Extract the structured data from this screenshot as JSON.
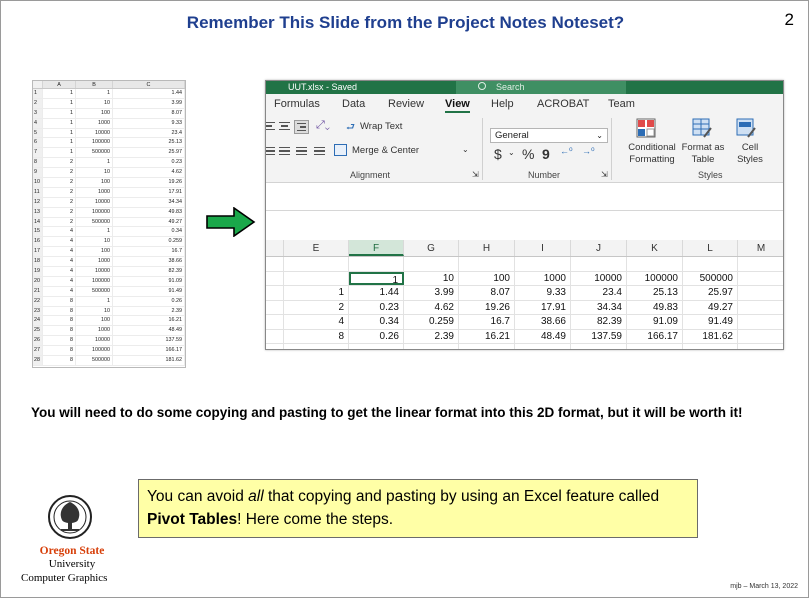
{
  "slide": {
    "title": "Remember This Slide from the Project Notes Noteset?",
    "page_number": "2",
    "body_text": "You will need to do some copying and pasting to get the linear format into this 2D format, but it will be worth it!",
    "callout": {
      "before_all": "You can avoid ",
      "all": "all",
      "after_all": " that copying and pasting by using an Excel feature called ",
      "pivot": "Pivot Tables",
      "after_pivot": "!  Here come the steps."
    },
    "logo": {
      "line1": "Oregon State",
      "line2": "University",
      "line3": "Computer Graphics",
      "icon": "oregon-state-tree-seal-icon"
    },
    "footer": "mjb – March 13, 2022",
    "arrow_color": "#1aa84a"
  },
  "linear_sheet": {
    "columns": [
      "",
      "A",
      "B",
      "C"
    ],
    "rows": [
      [
        "1",
        "1",
        "1",
        "1.44"
      ],
      [
        "2",
        "1",
        "10",
        "3.99"
      ],
      [
        "3",
        "1",
        "100",
        "8.07"
      ],
      [
        "4",
        "1",
        "1000",
        "9.33"
      ],
      [
        "5",
        "1",
        "10000",
        "23.4"
      ],
      [
        "6",
        "1",
        "100000",
        "25.13"
      ],
      [
        "7",
        "1",
        "500000",
        "25.97"
      ],
      [
        "8",
        "2",
        "1",
        "0.23"
      ],
      [
        "9",
        "2",
        "10",
        "4.62"
      ],
      [
        "10",
        "2",
        "100",
        "19.26"
      ],
      [
        "11",
        "2",
        "1000",
        "17.91"
      ],
      [
        "12",
        "2",
        "10000",
        "34.34"
      ],
      [
        "13",
        "2",
        "100000",
        "49.83"
      ],
      [
        "14",
        "2",
        "500000",
        "49.27"
      ],
      [
        "15",
        "4",
        "1",
        "0.34"
      ],
      [
        "16",
        "4",
        "10",
        "0.259"
      ],
      [
        "17",
        "4",
        "100",
        "16.7"
      ],
      [
        "18",
        "4",
        "1000",
        "38.66"
      ],
      [
        "19",
        "4",
        "10000",
        "82.39"
      ],
      [
        "20",
        "4",
        "100000",
        "91.09"
      ],
      [
        "21",
        "4",
        "500000",
        "91.49"
      ],
      [
        "22",
        "8",
        "1",
        "0.26"
      ],
      [
        "23",
        "8",
        "10",
        "2.39"
      ],
      [
        "24",
        "8",
        "100",
        "16.21"
      ],
      [
        "25",
        "8",
        "1000",
        "48.49"
      ],
      [
        "26",
        "8",
        "10000",
        "137.59"
      ],
      [
        "27",
        "8",
        "100000",
        "166.17"
      ],
      [
        "28",
        "8",
        "500000",
        "181.62"
      ]
    ]
  },
  "excel": {
    "file_name": "UUT.xlsx - Saved",
    "search_placeholder": "Search",
    "tabs": [
      "Formulas",
      "Data",
      "Review",
      "View",
      "Help",
      "ACROBAT",
      "Team"
    ],
    "active_tab": "View",
    "ribbon": {
      "wrap_text": "Wrap Text",
      "merge_center": "Merge & Center",
      "number_format": "General",
      "conditional_formatting_1": "Conditional",
      "conditional_formatting_2": "Formatting",
      "format_table_1": "Format as",
      "format_table_2": "Table",
      "cell_styles_1": "Cell",
      "cell_styles_2": "Styles",
      "group_alignment": "Alignment",
      "group_number": "Number",
      "group_styles": "Styles",
      "currency": "$",
      "percent": "%",
      "comma": "9"
    },
    "column_headers": [
      "E",
      "F",
      "G",
      "H",
      "I",
      "J",
      "K",
      "L",
      "M"
    ],
    "grid_rows": [
      [
        "",
        "",
        "",
        "",
        "",
        "",
        "",
        "",
        "",
        ""
      ],
      [
        "",
        "",
        "1",
        "10",
        "100",
        "1000",
        "10000",
        "100000",
        "500000",
        ""
      ],
      [
        "",
        "1",
        "1.44",
        "3.99",
        "8.07",
        "9.33",
        "23.4",
        "25.13",
        "25.97",
        ""
      ],
      [
        "",
        "2",
        "0.23",
        "4.62",
        "19.26",
        "17.91",
        "34.34",
        "49.83",
        "49.27",
        ""
      ],
      [
        "",
        "4",
        "0.34",
        "0.259",
        "16.7",
        "38.66",
        "82.39",
        "91.09",
        "91.49",
        ""
      ],
      [
        "",
        "8",
        "0.26",
        "2.39",
        "16.21",
        "48.49",
        "137.59",
        "166.17",
        "181.62",
        ""
      ],
      [
        "",
        "",
        "",
        "",
        "",
        "",
        "",
        "",
        "",
        ""
      ]
    ]
  }
}
